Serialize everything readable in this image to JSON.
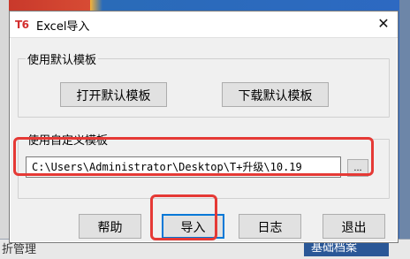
{
  "background": {
    "bottom_left_text": "折管理",
    "bottom_box_text": "基础档案"
  },
  "window": {
    "logo": "T6",
    "title": "Excel导入",
    "close_glyph": "✕"
  },
  "default_template_group": {
    "title": "使用默认模板",
    "open_button": "打开默认模板",
    "download_button": "下载默认模板"
  },
  "custom_template_group": {
    "title": "使用自定义模板",
    "path_value": "C:\\Users\\Administrator\\Desktop\\T+升级\\10.19",
    "browse_label": "..."
  },
  "footer_buttons": {
    "help": "帮助",
    "import": "导入",
    "log": "日志",
    "exit": "退出"
  },
  "annotations": {
    "highlight_color": "#e53935"
  }
}
